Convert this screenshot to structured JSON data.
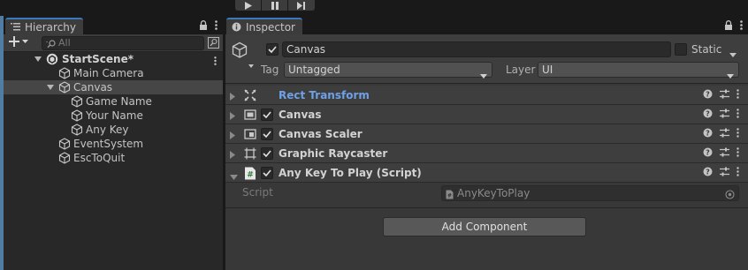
{
  "toolbar": {
    "play_icon": "play-icon",
    "pause_icon": "pause-icon",
    "step_icon": "step-icon"
  },
  "hierarchy": {
    "tab_label": "Hierarchy",
    "search_placeholder": "All",
    "scene": {
      "name": "StartScene*"
    },
    "objects": [
      {
        "label": "Main Camera",
        "depth": 1,
        "expandable": false,
        "selected": false
      },
      {
        "label": "Canvas",
        "depth": 1,
        "expandable": true,
        "selected": true
      },
      {
        "label": "Game Name",
        "depth": 2,
        "expandable": false,
        "selected": false
      },
      {
        "label": "Your Name",
        "depth": 2,
        "expandable": false,
        "selected": false
      },
      {
        "label": "Any Key",
        "depth": 2,
        "expandable": false,
        "selected": false
      },
      {
        "label": "EventSystem",
        "depth": 1,
        "expandable": false,
        "selected": false
      },
      {
        "label": "EscToQuit",
        "depth": 1,
        "expandable": false,
        "selected": false
      }
    ]
  },
  "inspector": {
    "tab_label": "Inspector",
    "object": {
      "active": true,
      "name": "Canvas",
      "static_label": "Static",
      "static": false,
      "tag_label": "Tag",
      "tag_value": "Untagged",
      "layer_label": "Layer",
      "layer_value": "UI"
    },
    "components": [
      {
        "title": "Rect Transform",
        "icon": "rect-transform-icon",
        "has_checkbox": false,
        "enabled": null,
        "expanded": false,
        "highlight": true
      },
      {
        "title": "Canvas",
        "icon": "canvas-icon",
        "has_checkbox": true,
        "enabled": true,
        "expanded": false,
        "highlight": false
      },
      {
        "title": "Canvas Scaler",
        "icon": "canvas-scaler-icon",
        "has_checkbox": true,
        "enabled": true,
        "expanded": false,
        "highlight": false
      },
      {
        "title": "Graphic Raycaster",
        "icon": "graphic-raycaster-icon",
        "has_checkbox": true,
        "enabled": true,
        "expanded": false,
        "highlight": false
      },
      {
        "title": "Any Key To Play (Script)",
        "icon": "script-icon",
        "has_checkbox": true,
        "enabled": true,
        "expanded": true,
        "highlight": false
      }
    ],
    "script_field": {
      "label": "Script",
      "value": "AnyKeyToPlay"
    },
    "add_component_label": "Add Component"
  },
  "colors": {
    "accent_tab": "#3a79bb",
    "rect_transform_title": "#6fa1e6",
    "panel_bg": "#383838",
    "hierarchy_bg": "#282828",
    "selected_row": "#464646"
  }
}
